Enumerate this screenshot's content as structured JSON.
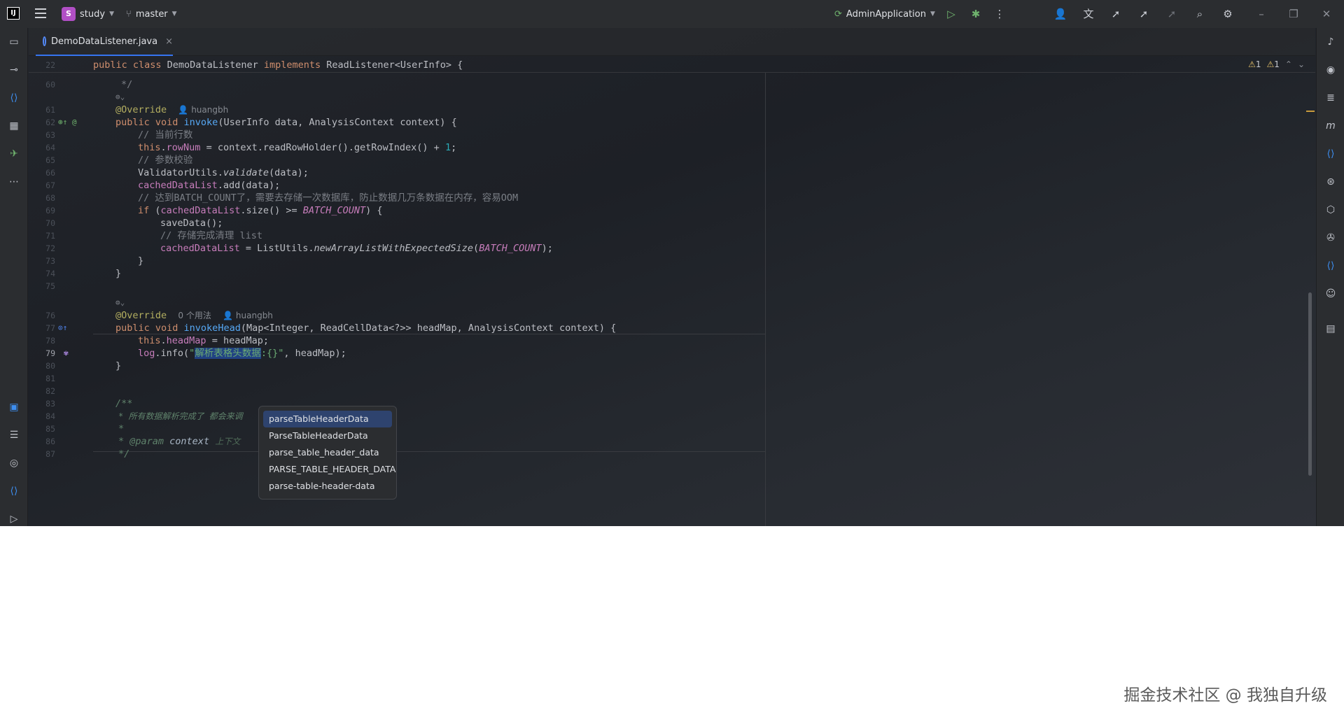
{
  "titlebar": {
    "project_badge": "S",
    "project_name": "study",
    "branch": "master",
    "run_config": "AdminApplication"
  },
  "tab": {
    "label": "DemoDataListener.java"
  },
  "inspections": {
    "warnings_1": "1",
    "warnings_2": "1"
  },
  "sticky": {
    "line_no": "22",
    "code": "public class DemoDataListener implements ReadListener<UserInfo> {"
  },
  "lines": {
    "l60": "60",
    "l61": "61",
    "l62": "62",
    "l63": "63",
    "l64": "64",
    "l65": "65",
    "l66": "66",
    "l67": "67",
    "l68": "68",
    "l69": "69",
    "l70": "70",
    "l71": "71",
    "l72": "72",
    "l73": "73",
    "l74": "74",
    "l75": "75",
    "l76": "76",
    "l77": "77",
    "l78": "78",
    "l79": "79",
    "l80": "80",
    "l81": "81",
    "l82": "82",
    "l83": "83",
    "l84": "84",
    "l85": "85",
    "l86": "86",
    "l87": "87"
  },
  "code": {
    "c60": "*/",
    "c61_ann": "@Override",
    "c61_author": "huangbh",
    "c63": "// 当前行数",
    "c65": "// 参数校验",
    "c68": "// 达到BATCH_COUNT了，需要去存储一次数据库，防止数据几万条数据在内存，容易OOM",
    "c71": "// 存储完成清理 list",
    "c76_ann": "@Override",
    "c76_usages": "0 个用法",
    "c76_author": "huangbh",
    "c79_str_sel": "解析表格头数据",
    "c79_str_rest": ":{}\"",
    "c83": "/**",
    "c84": "* 所有数据解析完成了 都会来调",
    "c85": "*",
    "c86_tag": "* @param",
    "c86_name": "context",
    "c86_desc": "上下文",
    "c87": "*/"
  },
  "popup": {
    "items": [
      "parseTableHeaderData",
      "ParseTableHeaderData",
      "parse_table_header_data",
      "PARSE_TABLE_HEADER_DATA",
      "parse-table-header-data"
    ]
  },
  "watermark": "掘金技术社区 @ 我独自升级"
}
